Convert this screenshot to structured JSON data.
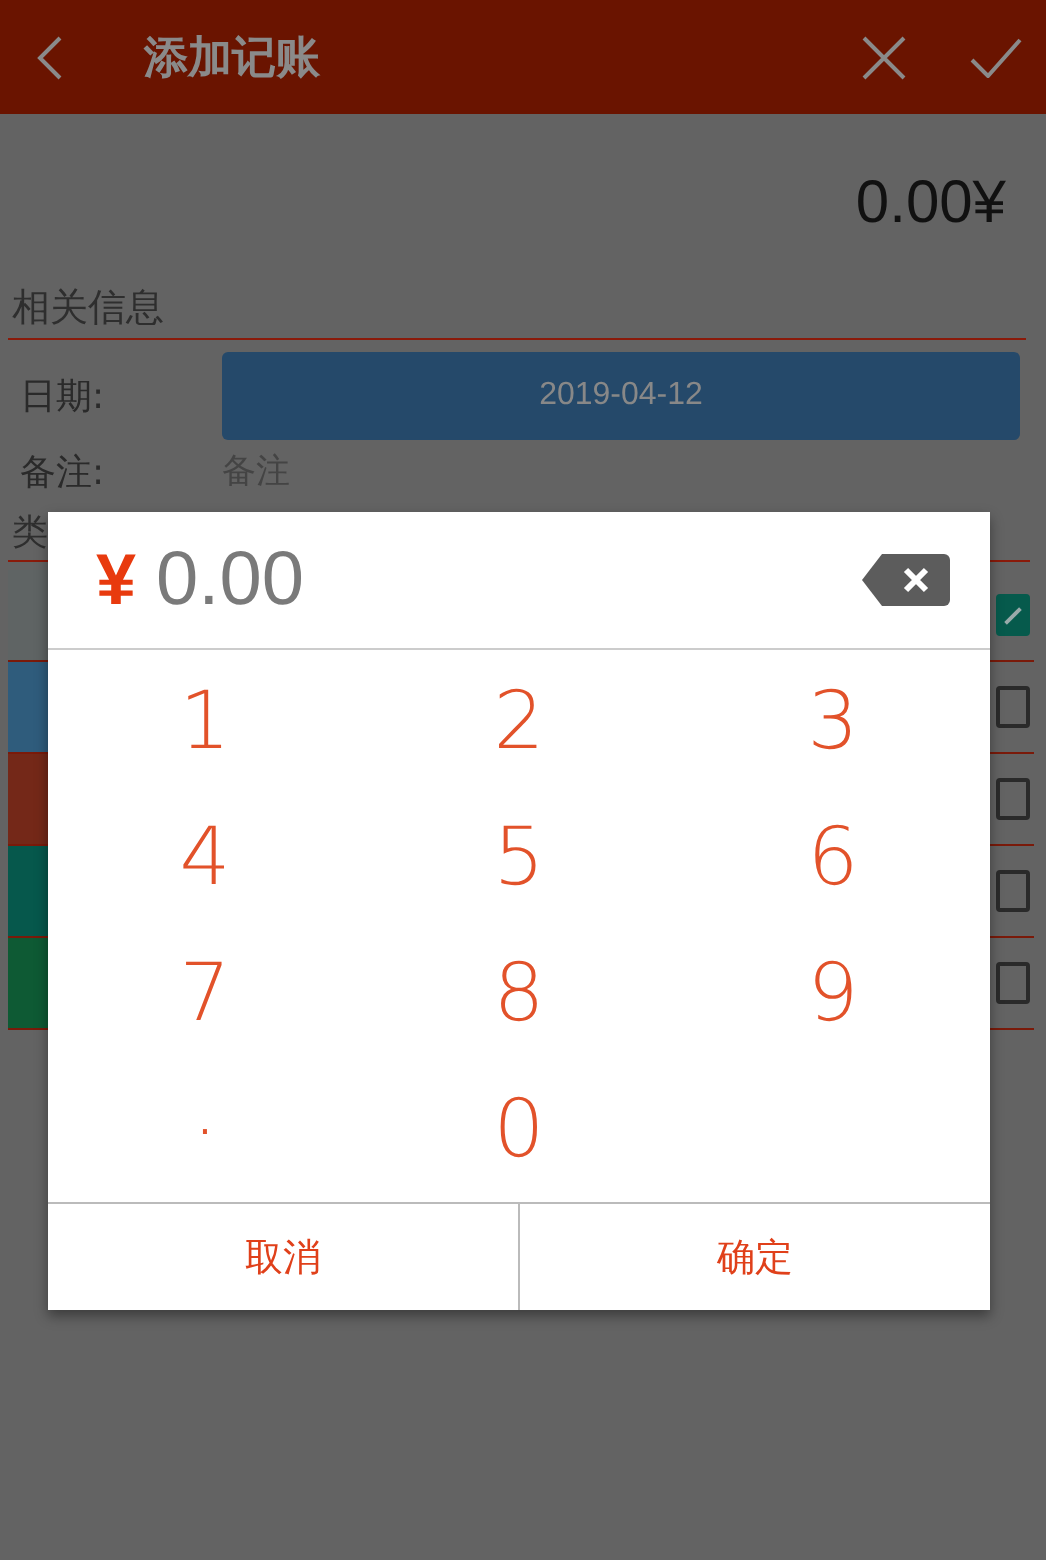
{
  "header": {
    "title": "添加记账"
  },
  "amount": "0.00¥",
  "section_title": "相关信息",
  "fields": [
    {
      "kind": "button",
      "label": "日期:",
      "value": "2019-04-12"
    },
    {
      "kind": "input",
      "label": "备注:",
      "placeholder": "备注"
    }
  ],
  "category_label": "类",
  "categories": [
    {
      "color": "#5f6464",
      "checked": true
    },
    {
      "color": "#2f5c7c",
      "checked": false
    },
    {
      "color": "#742818",
      "checked": false
    },
    {
      "color": "#06584c",
      "checked": false
    },
    {
      "color": "#0e5a34",
      "checked": false
    }
  ],
  "dialog": {
    "currency": "¥",
    "value": "0.00",
    "keys": [
      "1",
      "2",
      "3",
      "4",
      "5",
      "6",
      "7",
      "8",
      "9",
      ".",
      "0"
    ],
    "buttons": [
      "取消",
      "确定"
    ]
  }
}
